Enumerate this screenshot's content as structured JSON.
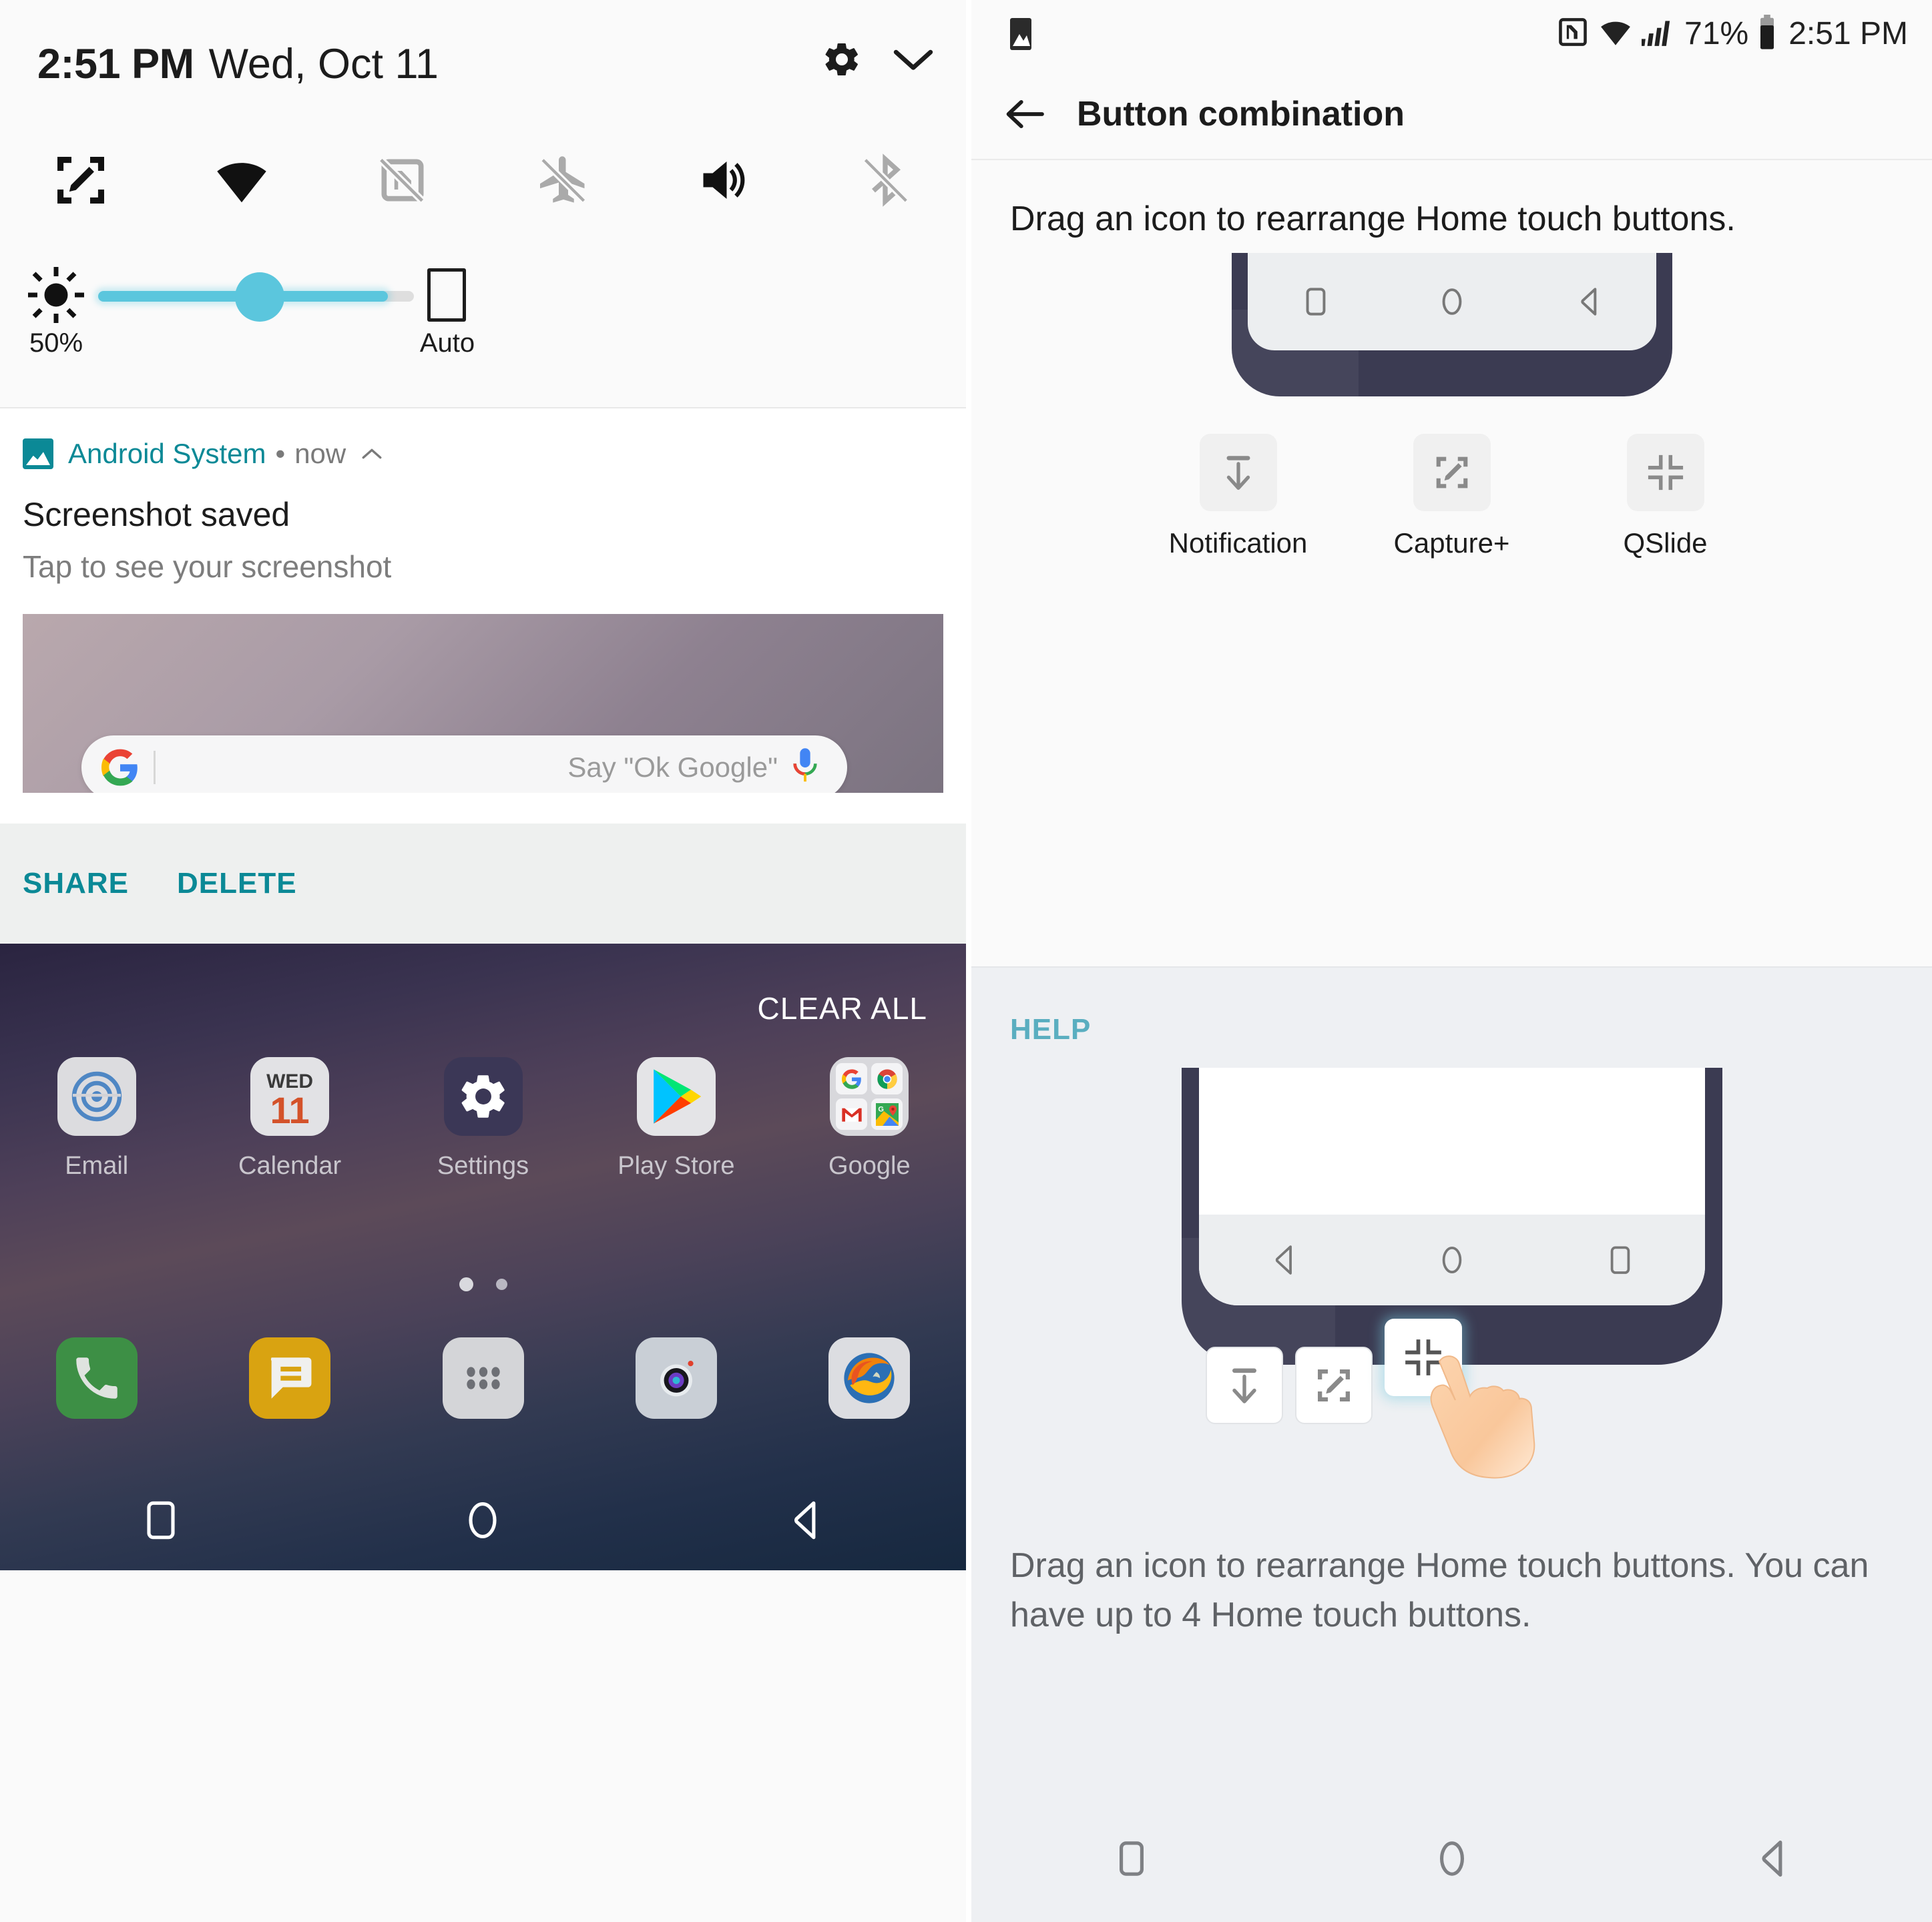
{
  "left_panel": {
    "quick_settings": {
      "time": "2:51 PM",
      "date": "Wed, Oct 11",
      "gear_icon": "gear-icon",
      "expand_icon": "chevron-down-icon",
      "toggles": [
        {
          "name": "capture-plus",
          "icon": "capture-plus-icon",
          "state": "on"
        },
        {
          "name": "wifi",
          "icon": "wifi-icon",
          "state": "on"
        },
        {
          "name": "nfc",
          "icon": "nfc-off-icon",
          "state": "off"
        },
        {
          "name": "airplane-mode",
          "icon": "airplane-off-icon",
          "state": "off"
        },
        {
          "name": "sound",
          "icon": "volume-on-icon",
          "state": "on"
        },
        {
          "name": "bluetooth",
          "icon": "bluetooth-off-icon",
          "state": "off"
        }
      ],
      "brightness": {
        "icon": "brightness-icon",
        "percent_label": "50%",
        "value": 50,
        "auto_label": "Auto",
        "auto_icon": "auto-brightness-box-icon"
      }
    },
    "notification": {
      "app_name": "Android System",
      "separator": "•",
      "time": "now",
      "collapse_icon": "chevron-up-icon",
      "title": "Screenshot saved",
      "subtitle": "Tap to see your screenshot",
      "preview": {
        "google_logo": "google-g-icon",
        "search_hint": "Say \"Ok Google\"",
        "mic_icon": "microphone-icon"
      },
      "actions": [
        "SHARE",
        "DELETE"
      ]
    },
    "home_screen": {
      "clear_all": "CLEAR ALL",
      "apps": [
        {
          "label": "Email",
          "icon": "email-icon"
        },
        {
          "label": "Calendar",
          "icon": "calendar-icon",
          "day": "WED",
          "date": "11"
        },
        {
          "label": "Settings",
          "icon": "settings-gear-icon"
        },
        {
          "label": "Play Store",
          "icon": "play-store-icon"
        },
        {
          "label": "Google",
          "icon": "google-folder-icon"
        }
      ],
      "page_dots": 2,
      "active_dot": 0,
      "dock": [
        {
          "name": "phone",
          "icon": "phone-icon"
        },
        {
          "name": "messages",
          "icon": "messages-icon"
        },
        {
          "name": "app-drawer",
          "icon": "app-drawer-icon"
        },
        {
          "name": "camera",
          "icon": "camera-icon"
        },
        {
          "name": "firefox",
          "icon": "firefox-icon"
        }
      ],
      "nav_buttons": [
        {
          "name": "recents",
          "icon": "recents-square-icon"
        },
        {
          "name": "home",
          "icon": "home-circle-icon"
        },
        {
          "name": "back",
          "icon": "back-triangle-icon"
        }
      ]
    }
  },
  "right_panel": {
    "status_bar": {
      "left_icon": "screenshot-notification-icon",
      "nfc_icon": "nfc-icon",
      "wifi_icon": "wifi-icon",
      "signal_icon": "signal-bars-icon",
      "battery_percent": "71%",
      "battery_icon": "battery-icon",
      "time": "2:51 PM"
    },
    "app_bar": {
      "back_icon": "back-arrow-icon",
      "title": "Button combination"
    },
    "main": {
      "instruction": "Drag an icon to rearrange Home touch buttons.",
      "preview_nav_buttons": [
        {
          "name": "recents",
          "icon": "recents-square-icon"
        },
        {
          "name": "home",
          "icon": "home-circle-icon"
        },
        {
          "name": "back",
          "icon": "back-triangle-icon"
        }
      ],
      "options": [
        {
          "label": "Notification",
          "icon": "notification-pulldown-icon"
        },
        {
          "label": "Capture+",
          "icon": "capture-plus-icon"
        },
        {
          "label": "QSlide",
          "icon": "qslide-icon"
        }
      ]
    },
    "help": {
      "section_title": "HELP",
      "figure_nav_buttons": [
        {
          "name": "back",
          "icon": "back-triangle-icon"
        },
        {
          "name": "home",
          "icon": "home-circle-icon"
        },
        {
          "name": "recents",
          "icon": "recents-square-icon"
        }
      ],
      "figure_tiles": [
        {
          "name": "notification-tile",
          "icon": "notification-pulldown-icon"
        },
        {
          "name": "capture-plus-tile",
          "icon": "capture-plus-icon"
        },
        {
          "name": "qslide-tile",
          "icon": "qslide-icon",
          "highlighted": true
        }
      ],
      "hand_icon": "pointing-hand-icon",
      "body_text": "Drag an icon to rearrange Home touch buttons. You can have up to 4 Home touch buttons."
    },
    "nav_buttons": [
      {
        "name": "recents",
        "icon": "recents-square-icon"
      },
      {
        "name": "home",
        "icon": "home-circle-icon"
      },
      {
        "name": "back",
        "icon": "back-triangle-icon"
      }
    ]
  },
  "colors": {
    "accent_teal": "#0b8996",
    "help_teal": "#5aaec0",
    "slider_blue": "#5bc6dd",
    "phone_navy": "#3b3b52"
  }
}
